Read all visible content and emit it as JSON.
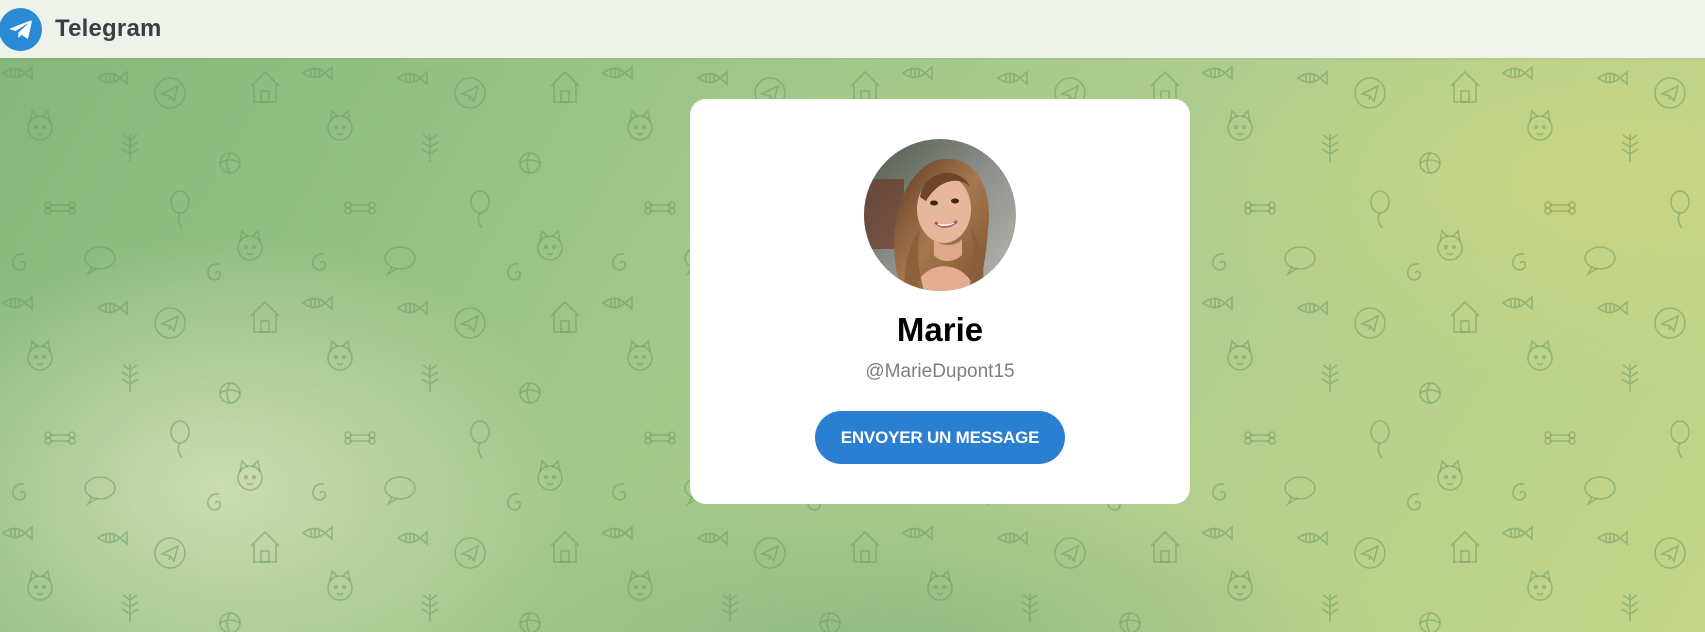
{
  "header": {
    "app_name": "Telegram",
    "logo_icon": "telegram-paper-plane-icon"
  },
  "profile": {
    "name": "Marie",
    "username": "@MarieDupont15",
    "avatar_icon": "profile-photo"
  },
  "actions": {
    "send_message_label": "ENVOYER UN MESSAGE"
  },
  "colors": {
    "accent": "#2a7fd0",
    "logo": "#2a8bd4",
    "background_start": "#86b77a",
    "background_end": "#c4d587",
    "card": "#ffffff"
  }
}
